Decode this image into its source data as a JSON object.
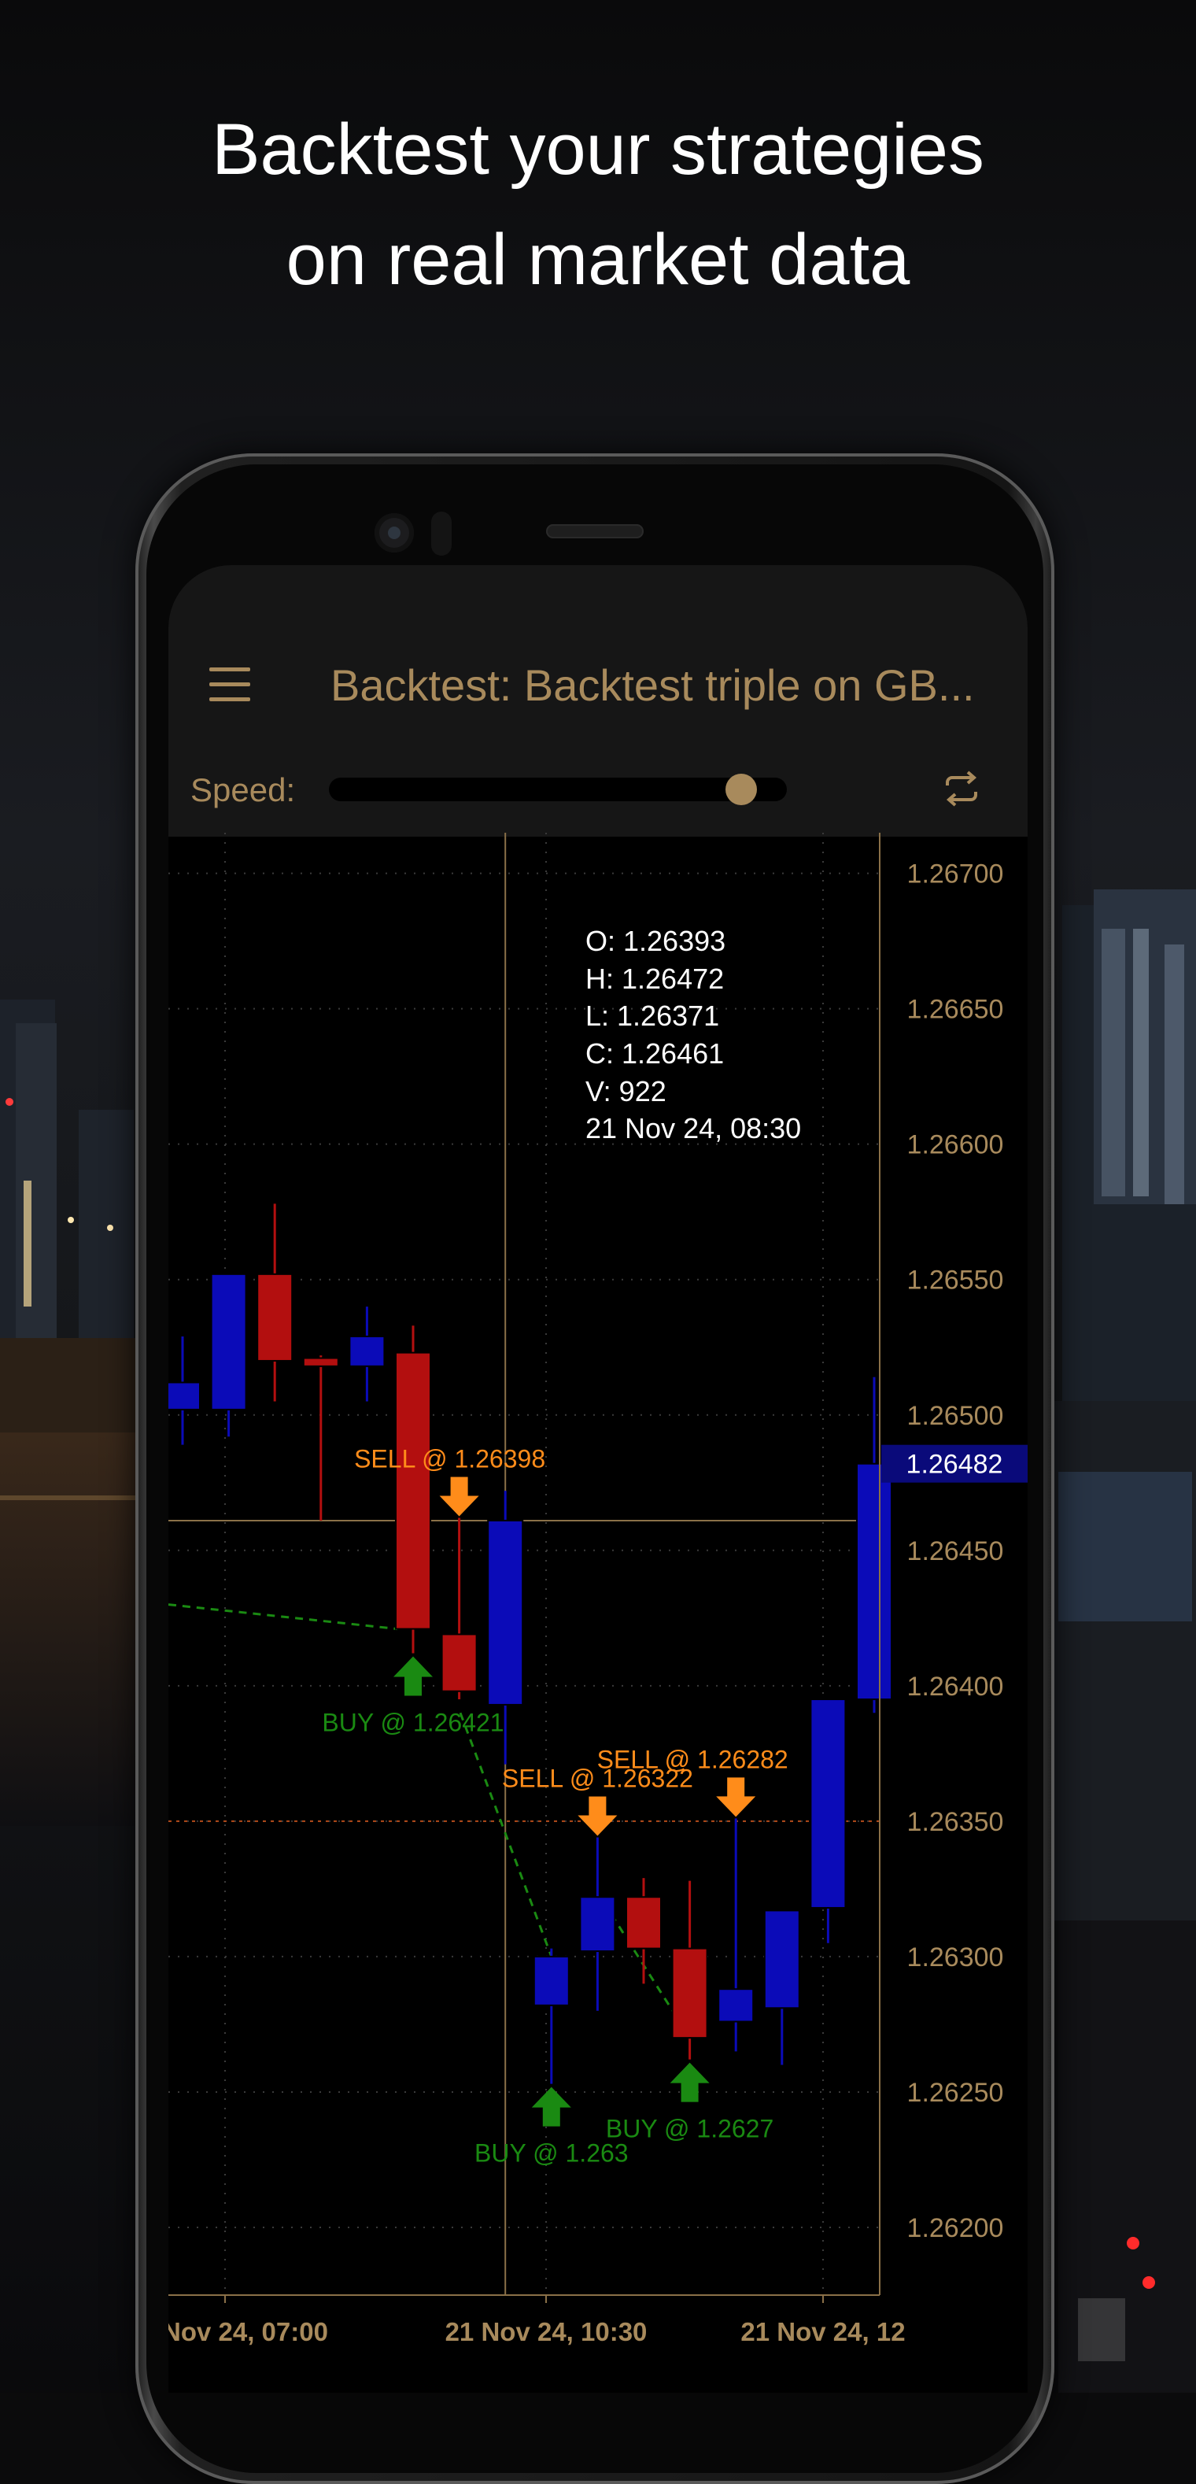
{
  "headline": {
    "line1": "Backtest your strategies",
    "line2": "on real market data"
  },
  "appbar": {
    "menu_icon": "hamburger-menu-icon",
    "title": "Backtest: Backtest triple on GB..."
  },
  "playback": {
    "speed_label": "Speed:",
    "speed": 0.93,
    "loop_icon": "repeat-icon"
  },
  "colors": {
    "accent": "#a88a5c",
    "bull": "#0b0bb8",
    "bear": "#b30f0f",
    "buy": "#1a8a12",
    "sell": "#ff8c1a",
    "last_price_bg": "#0a0a7a"
  },
  "chart_data": {
    "type": "candlestick",
    "ylim": [
      1.26175,
      1.26715
    ],
    "y_ticks": [
      "1.26700",
      "1.26650",
      "1.26600",
      "1.26550",
      "1.26500",
      "1.26450",
      "1.26400",
      "1.26350",
      "1.26300",
      "1.26250",
      "1.26200"
    ],
    "x_labels": [
      "Nov 24, 07:00",
      "21 Nov 24, 10:30",
      "21 Nov 24, 12"
    ],
    "candles": [
      {
        "o": 1.26502,
        "h": 1.26529,
        "l": 1.26489,
        "c": 1.26512
      },
      {
        "o": 1.26502,
        "h": 1.26552,
        "l": 1.26492,
        "c": 1.26552
      },
      {
        "o": 1.26552,
        "h": 1.26578,
        "l": 1.26505,
        "c": 1.2652
      },
      {
        "o": 1.26521,
        "h": 1.26522,
        "l": 1.26461,
        "c": 1.26518
      },
      {
        "o": 1.26518,
        "h": 1.2654,
        "l": 1.26505,
        "c": 1.26529
      },
      {
        "o": 1.26523,
        "h": 1.26533,
        "l": 1.26412,
        "c": 1.26421
      },
      {
        "o": 1.26419,
        "h": 1.26462,
        "l": 1.26395,
        "c": 1.26398
      },
      {
        "o": 1.26393,
        "h": 1.26472,
        "l": 1.26371,
        "c": 1.26461
      },
      {
        "o": 1.26282,
        "h": 1.26303,
        "l": 1.26253,
        "c": 1.263
      },
      {
        "o": 1.26302,
        "h": 1.26344,
        "l": 1.2628,
        "c": 1.26322
      },
      {
        "o": 1.26322,
        "h": 1.26329,
        "l": 1.2629,
        "c": 1.26303
      },
      {
        "o": 1.26303,
        "h": 1.26328,
        "l": 1.26262,
        "c": 1.2627
      },
      {
        "o": 1.26276,
        "h": 1.26351,
        "l": 1.26265,
        "c": 1.26288
      },
      {
        "o": 1.26281,
        "h": 1.26317,
        "l": 1.2626,
        "c": 1.26317
      },
      {
        "o": 1.26318,
        "h": 1.26395,
        "l": 1.26305,
        "c": 1.26395
      },
      {
        "o": 1.26395,
        "h": 1.26514,
        "l": 1.2639,
        "c": 1.26482
      }
    ],
    "trades": [
      {
        "side": "SELL",
        "label": "SELL @ 1.26398",
        "candle": 6
      },
      {
        "side": "BUY",
        "label": "BUY @ 1.26421",
        "candle": 5
      },
      {
        "side": "SELL",
        "label": "SELL @ 1.26322",
        "candle": 9
      },
      {
        "side": "SELL",
        "label": "SELL @ 1.26282",
        "candle": 12
      },
      {
        "side": "BUY",
        "label": "BUY @ 1.263",
        "candle": 8
      },
      {
        "side": "BUY",
        "label": "BUY @ 1.2627",
        "candle": 11
      }
    ],
    "crosshair": {
      "candle": 7,
      "price": 1.26461
    },
    "level_line": 1.2635,
    "last_price": "1.26482",
    "ohlc_tooltip": {
      "o": "O: 1.26393",
      "h": "H: 1.26472",
      "l": "L: 1.26371",
      "c": "C: 1.26461",
      "v": "V: 922",
      "time": "21 Nov 24, 08:30"
    }
  }
}
